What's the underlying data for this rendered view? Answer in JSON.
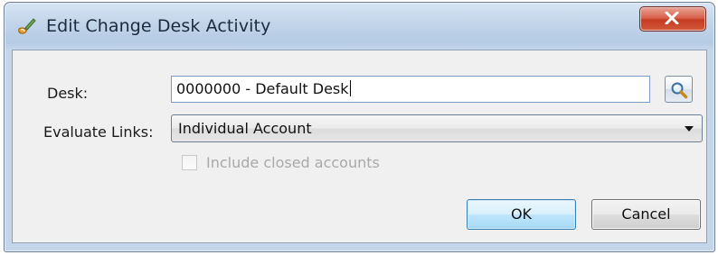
{
  "window": {
    "title": "Edit Change Desk Activity",
    "icon": "brush-icon",
    "close_icon": "close-x-icon"
  },
  "form": {
    "desk_label": "Desk:",
    "desk_value": "0000000 - Default Desk",
    "desk_lookup_icon": "magnifier-icon",
    "evaluate_links_label": "Evaluate Links:",
    "evaluate_links_value": "Individual Account",
    "include_closed_label": "Include closed accounts",
    "include_closed_checked": false,
    "include_closed_enabled": false
  },
  "buttons": {
    "ok_label": "OK",
    "cancel_label": "Cancel"
  },
  "colors": {
    "titlebar": "#c2d5ea",
    "close_button": "#c43a22",
    "ok_button": "#bee6fd",
    "disabled_text": "#a9a9a9"
  }
}
